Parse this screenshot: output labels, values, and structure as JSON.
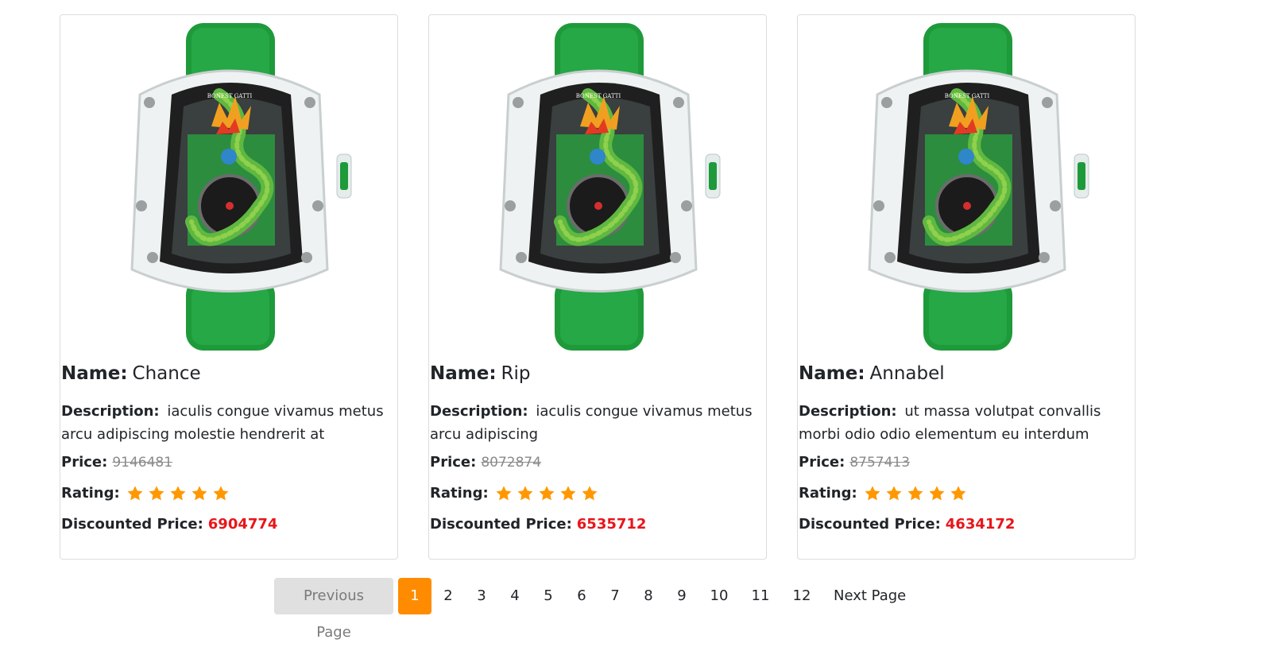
{
  "labels": {
    "name": "Name:",
    "description": "Description:",
    "price": "Price:",
    "rating": "Rating:",
    "discounted_price": "Discounted Price:"
  },
  "colors": {
    "accent": "#ff8c00",
    "discount": "#e8161b",
    "strap": "#1e9a3a",
    "star": "#ff9800"
  },
  "products": [
    {
      "name": "Chance",
      "description": "iaculis congue vivamus metus arcu adipiscing molestie hendrerit at",
      "price": "9146481",
      "rating": 5,
      "rating_max": 5,
      "discounted_price": "6904774",
      "image_icon": "green-dragon-watch-image"
    },
    {
      "name": "Rip",
      "description": "iaculis congue vivamus metus arcu adipiscing",
      "price": "8072874",
      "rating": 5,
      "rating_max": 5,
      "discounted_price": "6535712",
      "image_icon": "green-dragon-watch-image"
    },
    {
      "name": "Annabel",
      "description": "ut massa volutpat convallis morbi odio odio elementum eu interdum",
      "price": "8757413",
      "rating": 5,
      "rating_max": 5,
      "discounted_price": "4634172",
      "image_icon": "green-dragon-watch-image"
    }
  ],
  "pagination": {
    "previous_label": "Previous Page",
    "next_label": "Next Page",
    "current_page": "1",
    "pages": [
      "1",
      "2",
      "3",
      "4",
      "5",
      "6",
      "7",
      "8",
      "9",
      "10",
      "11",
      "12"
    ],
    "watch_brand": "BONEST GATTI"
  }
}
